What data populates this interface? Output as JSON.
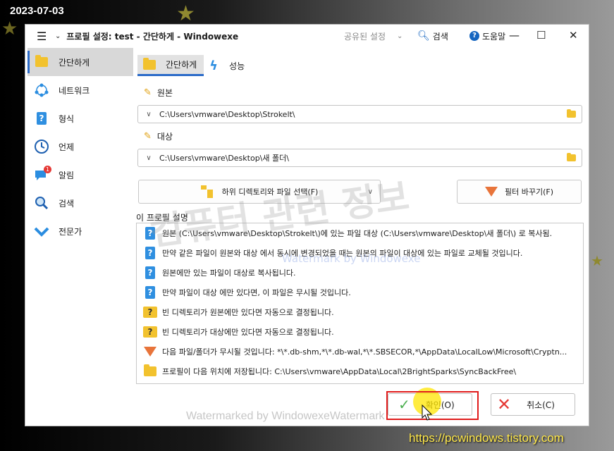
{
  "overlay": {
    "date": "2023-07-03",
    "url": "https://pcwindows.tistory.com",
    "watermark_big": "컴퓨터 관련 정보",
    "watermark_mid": "Watermark by Windowexe",
    "watermark_bottom": "Watermarked by WindowexeWatermark"
  },
  "titlebar": {
    "title": "프로필 설정: test - 간단하게   - Windowexe",
    "shared_settings": "공유된 설정",
    "search": "검색",
    "help": "도움말",
    "minimize": "—",
    "maximize": "☐",
    "close": "✕"
  },
  "sidebar": {
    "items": [
      {
        "label": "간단하게",
        "icon": "folder-icon"
      },
      {
        "label": "네트워크",
        "icon": "network-icon"
      },
      {
        "label": "형식",
        "icon": "question-icon"
      },
      {
        "label": "언제",
        "icon": "clock-icon"
      },
      {
        "label": "알림",
        "icon": "notification-icon",
        "badge": "1"
      },
      {
        "label": "검색",
        "icon": "search-icon"
      },
      {
        "label": "전문가",
        "icon": "chevron-down-icon"
      }
    ]
  },
  "tabs": [
    {
      "label": "간단하게"
    },
    {
      "label": "성능"
    }
  ],
  "source": {
    "label": "원본",
    "path": "C:\\Users\\vmware\\Desktop\\Strokelt\\"
  },
  "destination": {
    "label": "대상",
    "path": "C:\\Users\\vmware\\Desktop\\새 폴더\\"
  },
  "buttons": {
    "subfolders": "하위 디렉토리와 파일 선택(F)",
    "change_filter": "필터 바꾸기(F)",
    "ok": "확인(O)",
    "cancel": "취소(C)"
  },
  "description": {
    "title": "이 프로필 설명",
    "rows": [
      {
        "icon": "blue-question-icon",
        "text": "원본 (C:\\Users\\vmware\\Desktop\\Strokelt\\)에 있는 파일 대상 (C:\\Users\\vmware\\Desktop\\새 폴더\\) 로 복사됨."
      },
      {
        "icon": "blue-question-icon",
        "text": "만약 같은 파일이 원본와 대상 에서 동시에 변경되었을 때는 원본의 파일이 대상에 있는 파일로 교체될 것입니다."
      },
      {
        "icon": "blue-question-icon",
        "text": "원본에만 있는 파일이 대상로 복사됩니다."
      },
      {
        "icon": "blue-question-icon",
        "text": "만약 파일이 대상 에만 있다면, 이 파일은 무시될 것입니다."
      },
      {
        "icon": "yellow-question-icon",
        "text": "빈 디렉토리가 원본에만 있다면 자동으로 결정됩니다."
      },
      {
        "icon": "yellow-question-icon",
        "text": "빈 디렉토리가 대상에만 있다면 자동으로 결정됩니다."
      },
      {
        "icon": "filter-icon",
        "text": "다음 파일/폴더가 무시될 것입니다: *\\*.db-shm,*\\*.db-wal,*\\*.SBSECOR,*\\AppData\\LocalLow\\Microsoft\\Cryptn..."
      },
      {
        "icon": "folder-icon",
        "text": "프로필이 다음 위치에 저장됩니다: C:\\Users\\vmware\\AppData\\Local\\2BrightSparks\\SyncBackFree\\"
      }
    ]
  }
}
